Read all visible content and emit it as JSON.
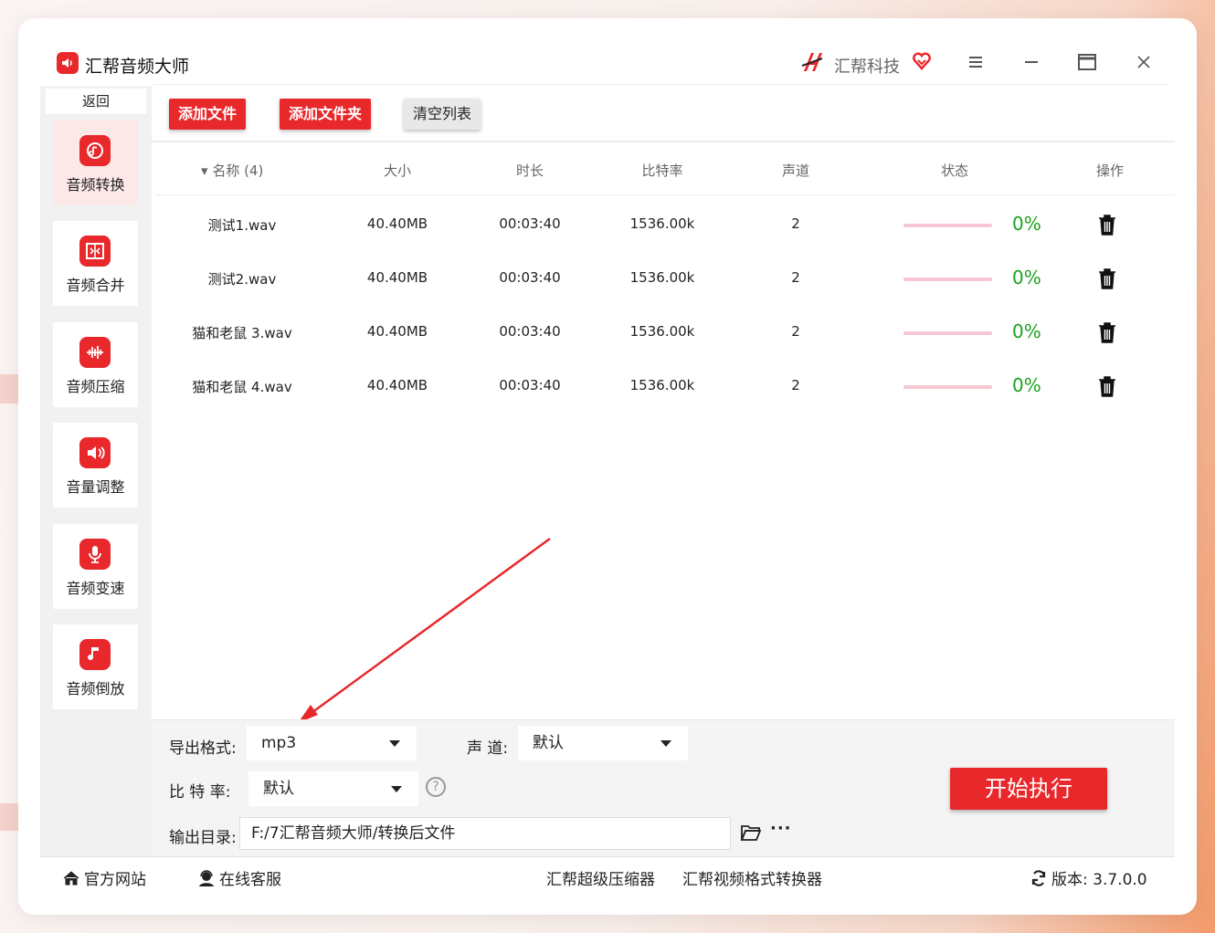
{
  "app": {
    "title": "汇帮音频大师",
    "brand": "汇帮科技",
    "accent_color": "#e8282b"
  },
  "window_controls": {
    "menu_icon": "hamburger-menu-icon",
    "minimize_icon": "minimize-icon",
    "maximize_icon": "maximize-icon",
    "close_icon": "close-icon"
  },
  "sidebar": {
    "back_label": "返回",
    "items": [
      {
        "label": "音频转换",
        "icon": "audio-convert-icon",
        "active": true
      },
      {
        "label": "音频合并",
        "icon": "audio-merge-icon",
        "active": false
      },
      {
        "label": "音频压缩",
        "icon": "audio-compress-icon",
        "active": false
      },
      {
        "label": "音量调整",
        "icon": "volume-adjust-icon",
        "active": false
      },
      {
        "label": "音频变速",
        "icon": "audio-speed-icon",
        "active": false
      },
      {
        "label": "音频倒放",
        "icon": "audio-reverse-icon",
        "active": false
      }
    ]
  },
  "toolbar": {
    "add_file_label": "添加文件",
    "add_folder_label": "添加文件夹",
    "clear_list_label": "清空列表"
  },
  "table": {
    "headers": {
      "name": "名称 (4)",
      "size": "大小",
      "duration": "时长",
      "bitrate": "比特率",
      "channels": "声道",
      "status": "状态",
      "actions": "操作"
    },
    "rows": [
      {
        "name": "测试1.wav",
        "size": "40.40MB",
        "duration": "00:03:40",
        "bitrate": "1536.00k",
        "channels": "2",
        "progress_text": "0%",
        "progress": 0
      },
      {
        "name": "测试2.wav",
        "size": "40.40MB",
        "duration": "00:03:40",
        "bitrate": "1536.00k",
        "channels": "2",
        "progress_text": "0%",
        "progress": 0
      },
      {
        "name": "猫和老鼠 3.wav",
        "size": "40.40MB",
        "duration": "00:03:40",
        "bitrate": "1536.00k",
        "channels": "2",
        "progress_text": "0%",
        "progress": 0
      },
      {
        "name": "猫和老鼠 4.wav",
        "size": "40.40MB",
        "duration": "00:03:40",
        "bitrate": "1536.00k",
        "channels": "2",
        "progress_text": "0%",
        "progress": 0
      }
    ]
  },
  "settings": {
    "format_label": "导出格式:",
    "format_value": "mp3",
    "channel_label": "声 道:",
    "channel_value": "默认",
    "bitrate_label": "比 特 率:",
    "bitrate_value": "默认",
    "output_label": "输出目录:",
    "output_path": "F:/7汇帮音频大师/转换后文件",
    "more_label": "···",
    "start_label": "开始执行"
  },
  "footer": {
    "website_label": "官方网站",
    "support_label": "在线客服",
    "link1_label": "汇帮超级压缩器",
    "link2_label": "汇帮视频格式转换器",
    "version_label": "版本:",
    "version_value": "3.7.0.0"
  }
}
